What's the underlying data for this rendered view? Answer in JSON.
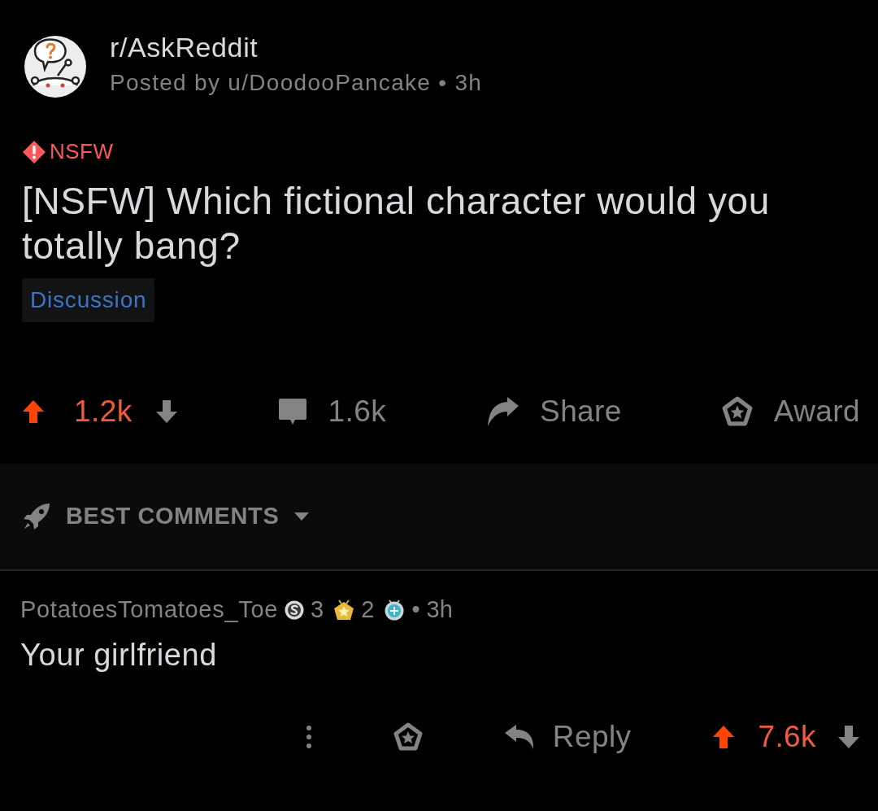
{
  "post": {
    "subreddit": "r/AskReddit",
    "byline": "Posted by u/DoodooPancake • 3h",
    "nsfw_tag": "NSFW",
    "title": "[NSFW] Which fictional character would you totally bang?",
    "flair": "Discussion"
  },
  "post_actions": {
    "upvoted": true,
    "score": "1.2k",
    "comments": "1.6k",
    "share": "Share",
    "award": "Award"
  },
  "sort": {
    "label": "BEST COMMENTS"
  },
  "comment": {
    "author": "PotatoesTomatoes_Toe",
    "awards": [
      {
        "kind": "silver",
        "count": "3"
      },
      {
        "kind": "gold",
        "count": "2"
      },
      {
        "kind": "round"
      }
    ],
    "time": "• 3h",
    "body": "Your girlfriend",
    "reply": "Reply",
    "upvoted": true,
    "score": "7.6k"
  }
}
